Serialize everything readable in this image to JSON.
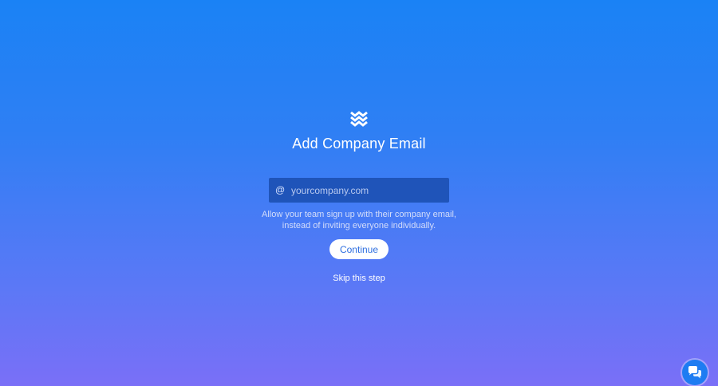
{
  "page": {
    "title": "Add Company Email",
    "logo_icon": "wave-logo-icon"
  },
  "email": {
    "prefix": "@",
    "placeholder": "yourcompany.com",
    "value": ""
  },
  "hint": {
    "line1": "Allow your team sign up with their company email,",
    "line2": "instead of inviting everyone individually."
  },
  "actions": {
    "continue_label": "Continue",
    "skip_label": "Skip this step"
  },
  "chat": {
    "icon": "chat-bubbles-icon"
  },
  "colors": {
    "gradient_top": "#1a82f5",
    "gradient_bottom": "#7a6ff7",
    "input_bg": "#1f54b9",
    "button_text": "#2f6fe0"
  }
}
